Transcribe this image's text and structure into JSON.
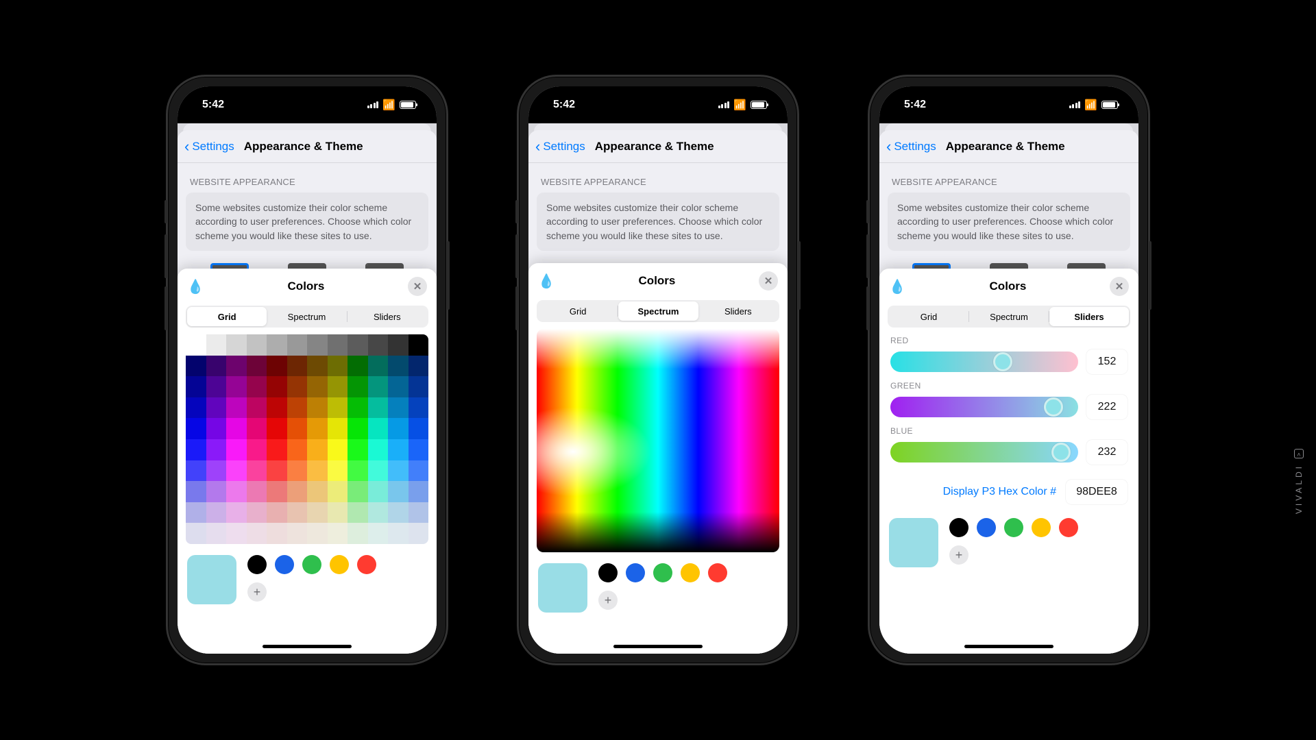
{
  "status": {
    "time": "5:42"
  },
  "nav": {
    "back": "Settings",
    "title": "Appearance & Theme"
  },
  "section": {
    "header": "WEBSITE APPEARANCE",
    "info": "Some websites customize their color scheme according to user preferences. Choose which color scheme you would like these sites to use."
  },
  "colors_sheet": {
    "title": "Colors",
    "tabs": [
      "Grid",
      "Spectrum",
      "Sliders"
    ],
    "selected_swatch": "#99dde6",
    "preset_swatches": [
      "#000000",
      "#1b63e8",
      "#2fbf4d",
      "#ffc400",
      "#ff3b30"
    ]
  },
  "sliders": {
    "labels": {
      "red": "RED",
      "green": "GREEN",
      "blue": "BLUE"
    },
    "red": {
      "value": 152,
      "track_grad": [
        "#28e0e5",
        "#ffc0d0"
      ],
      "thumb_pos": 0.6
    },
    "green": {
      "value": 222,
      "track_grad": [
        "#a020f0",
        "#8ae0e2"
      ],
      "thumb_pos": 0.87
    },
    "blue": {
      "value": 232,
      "track_grad": [
        "#7ed321",
        "#89d7ff"
      ],
      "thumb_pos": 0.91
    },
    "hex_label": "Display P3 Hex Color #",
    "hex_value": "98DEE8"
  },
  "brand": "VIVALDI",
  "grid_palette": {
    "row_gray": [
      "#ffffff",
      "#ebebeb",
      "#d6d6d6",
      "#c2c2c2",
      "#adadad",
      "#999999",
      "#858585",
      "#707070",
      "#5c5c5c",
      "#474747",
      "#333333",
      "#000000"
    ],
    "hues": [
      "#003366",
      "#004d99",
      "#0066cc",
      "#0080ff",
      "#3399ff",
      "#66b2ff",
      "#99ccff",
      "#cce5ff",
      "#330066",
      "#4d0099",
      "#6600cc",
      "#8000ff",
      "#9933ff",
      "#b266ff",
      "#cc99ff",
      "#e5ccff"
    ]
  }
}
